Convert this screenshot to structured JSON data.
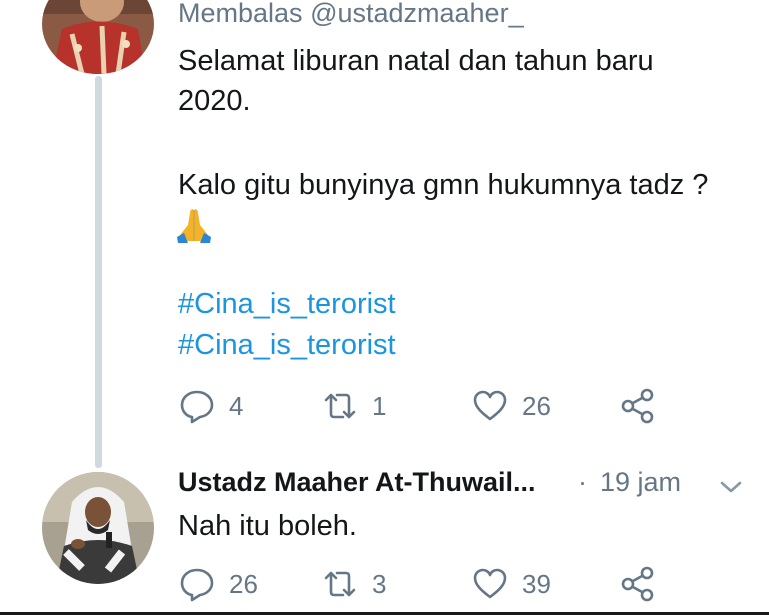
{
  "parent_tweet": {
    "reply_prefix": "Membalas",
    "reply_handle": "@ustadzmaaher_",
    "text_lines": [
      "Selamat liburan natal dan tahun baru",
      "2020.",
      "Kalo gitu bunyinya gmn hukumnya tadz ?"
    ],
    "emoji": "folded-hands-emoji",
    "hashtags": [
      "#Cina_is_terorist",
      "#Cina_is_terorist"
    ],
    "actions": {
      "reply_count": "4",
      "retweet_count": "1",
      "like_count": "26"
    }
  },
  "reply_tweet": {
    "author_name": "Ustadz Maaher At-Thuwail...",
    "separator": "·",
    "time": "19 jam",
    "text": "Nah itu boleh.",
    "actions": {
      "reply_count": "26",
      "retweet_count": "3",
      "like_count": "39"
    }
  },
  "icons": {
    "reply": "reply-icon",
    "retweet": "retweet-icon",
    "like": "heart-icon",
    "share": "share-icon",
    "menu": "chevron-down-icon"
  },
  "colors": {
    "text": "#14171a",
    "muted": "#657786",
    "hashtag": "#1b95e0",
    "thread_line": "#cfd9de"
  }
}
